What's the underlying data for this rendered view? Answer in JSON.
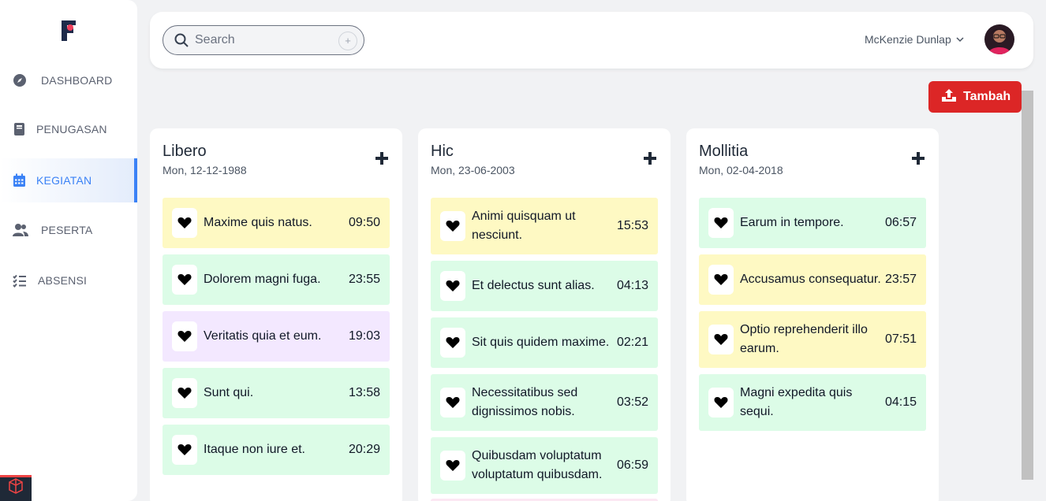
{
  "sidebar": {
    "items": [
      {
        "label": "DASHBOARD",
        "icon": "compass-icon"
      },
      {
        "label": "PENUGASAN",
        "icon": "book-icon"
      },
      {
        "label": "KEGIATAN",
        "icon": "calendar-icon",
        "active": true
      },
      {
        "label": "PESERTA",
        "icon": "users-icon"
      },
      {
        "label": "ABSENSI",
        "icon": "checklist-icon"
      }
    ]
  },
  "header": {
    "search_placeholder": "Search",
    "user_name": "McKenzie Dunlap"
  },
  "actions": {
    "tambah_label": "Tambah"
  },
  "colors": {
    "accent": "#3b82f6",
    "danger": "#dc2626",
    "yellow_card": "#fef9c3",
    "green_card": "#dcfce7",
    "purple_card": "#f3e8ff"
  },
  "columns": [
    {
      "title": "Libero",
      "date": "Mon, 12-12-1988",
      "tasks": [
        {
          "name": "Maxime quis natus.",
          "time": "09:50",
          "color": "yellow"
        },
        {
          "name": "Dolorem magni fuga.",
          "time": "23:55",
          "color": "green"
        },
        {
          "name": "Veritatis quia et eum.",
          "time": "19:03",
          "color": "purple"
        },
        {
          "name": "Sunt qui.",
          "time": "13:58",
          "color": "green"
        },
        {
          "name": "Itaque non iure et.",
          "time": "20:29",
          "color": "green"
        }
      ]
    },
    {
      "title": "Hic",
      "date": "Mon, 23-06-2003",
      "tasks": [
        {
          "name": "Animi quisquam ut nesciunt.",
          "time": "15:53",
          "color": "yellow"
        },
        {
          "name": "Et delectus sunt alias.",
          "time": "04:13",
          "color": "green"
        },
        {
          "name": "Sit quis quidem maxime.",
          "time": "02:21",
          "color": "green"
        },
        {
          "name": "Necessitatibus sed dignissimos nobis.",
          "time": "03:52",
          "color": "green"
        },
        {
          "name": "Quibusdam voluptatum voluptatum quibusdam.",
          "time": "06:59",
          "color": "green"
        }
      ]
    },
    {
      "title": "Mollitia",
      "date": "Mon, 02-04-2018",
      "tasks": [
        {
          "name": "Earum in tempore.",
          "time": "06:57",
          "color": "green"
        },
        {
          "name": "Accusamus consequatur.",
          "time": "23:57",
          "color": "yellow"
        },
        {
          "name": "Optio reprehenderit illo earum.",
          "time": "07:51",
          "color": "yellow"
        },
        {
          "name": "Magni expedita quis sequi.",
          "time": "04:15",
          "color": "green"
        }
      ]
    }
  ]
}
